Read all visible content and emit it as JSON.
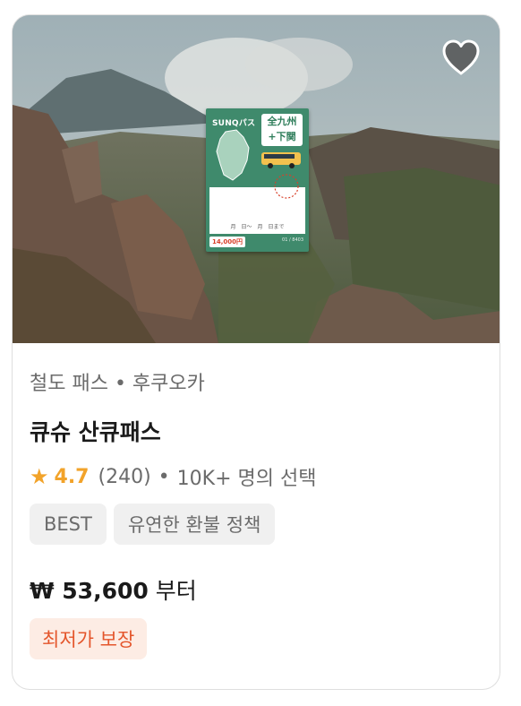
{
  "product": {
    "category": "철도 패스 • 후쿠오카",
    "title": "큐슈 산큐패스",
    "rating": {
      "value": "4.7",
      "review_count": "(240)",
      "separator": "•",
      "popularity": "10K+ 명의 선택"
    },
    "tags": [
      "BEST",
      "유연한 환불 정책"
    ],
    "price": {
      "amount": "₩ 53,600",
      "suffix": "부터"
    },
    "badge": "최저가 보장",
    "wishlisted": false
  },
  "image": {
    "pass_card": {
      "logo": "SUNQパス",
      "region_line1": "全九州",
      "region_line2": "+下関",
      "date_line": "月　日〜　月　日まで",
      "price": "14,000円",
      "code": "01 / 8403"
    }
  },
  "icons": {
    "wishlist": "heart-icon",
    "rating": "star-icon"
  },
  "colors": {
    "accent_star": "#f2a32a",
    "badge_text": "#e4552b",
    "badge_bg": "#fdece4",
    "tag_bg": "#f0f0f0",
    "pass_green": "#3f8a6c"
  }
}
